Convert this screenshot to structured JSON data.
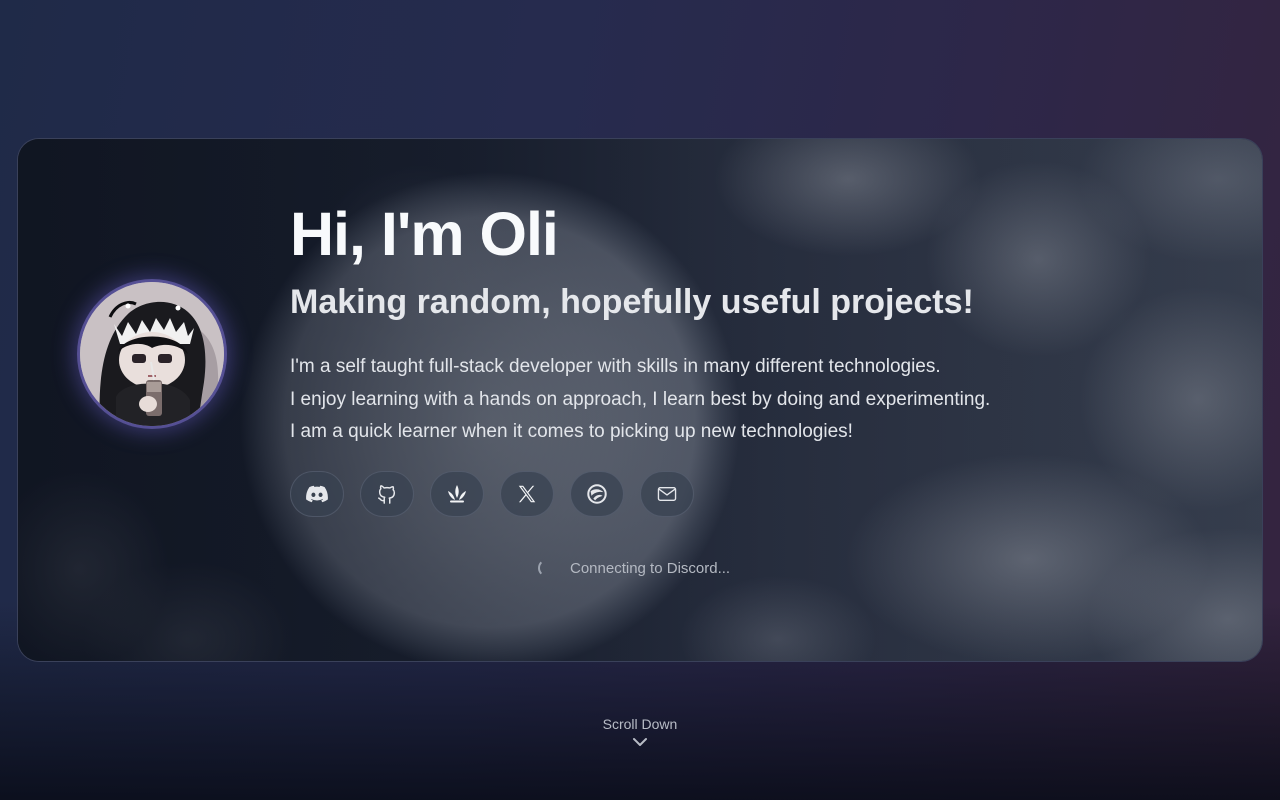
{
  "hero": {
    "title": "Hi, I'm Oli",
    "subtitle": "Making random, hopefully useful projects!",
    "bio": [
      "I'm a self taught full-stack developer with skills in many different technologies.",
      "I enjoy learning with a hands on approach, I learn best by doing and experimenting.",
      "I am a quick learner when it comes to picking up new technologies!"
    ],
    "status_text": "Connecting to Discord..."
  },
  "socials": [
    {
      "icon": "discord-icon"
    },
    {
      "icon": "github-icon"
    },
    {
      "icon": "crown-icon"
    },
    {
      "icon": "x-icon"
    },
    {
      "icon": "globe-icon"
    },
    {
      "icon": "mail-icon"
    }
  ],
  "scroll": {
    "label": "Scroll Down",
    "icon": "chevron-down-icon"
  },
  "colors": {
    "accent_glow": "#6e64d2",
    "button_bg": "#374151",
    "text_primary": "#f8fafc"
  }
}
